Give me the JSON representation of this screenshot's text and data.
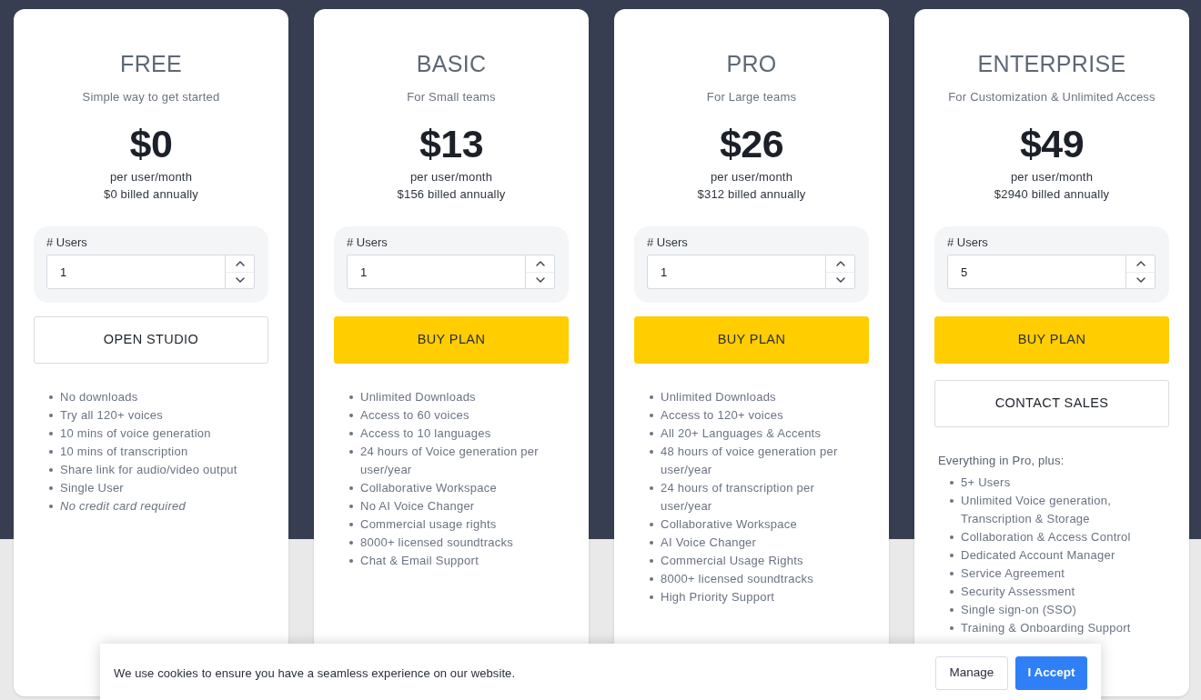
{
  "plans": [
    {
      "name": "FREE",
      "tagline": "Simple way to get started",
      "price": "$0",
      "period": "per user/month",
      "billed": "$0 billed annually",
      "users": {
        "label": "# Users",
        "value": "1"
      },
      "buttons": [
        {
          "label": "OPEN STUDIO",
          "kind": "outline"
        }
      ],
      "features": [
        "No downloads",
        "Try all 120+ voices",
        "10 mins of voice generation",
        "10 mins of transcription",
        "Share link for audio/video output",
        "Single User"
      ],
      "note": "No credit card required"
    },
    {
      "name": "BASIC",
      "tagline": "For Small teams",
      "price": "$13",
      "period": "per user/month",
      "billed": "$156 billed annually",
      "users": {
        "label": "# Users",
        "value": "1"
      },
      "buttons": [
        {
          "label": "BUY PLAN",
          "kind": "primary"
        }
      ],
      "features": [
        "Unlimited Downloads",
        "Access to 60 voices",
        "Access to 10 languages",
        "24 hours of Voice generation per user/year",
        "Collaborative Workspace",
        "No AI Voice Changer",
        "Commercial usage rights",
        "8000+ licensed soundtracks",
        "Chat & Email Support"
      ]
    },
    {
      "name": "PRO",
      "tagline": "For Large teams",
      "price": "$26",
      "period": "per user/month",
      "billed": "$312 billed annually",
      "users": {
        "label": "# Users",
        "value": "1"
      },
      "buttons": [
        {
          "label": "BUY PLAN",
          "kind": "primary"
        }
      ],
      "features": [
        "Unlimited Downloads",
        "Access to 120+ voices",
        "All 20+ Languages & Accents",
        "48 hours of voice generation per user/year",
        "24 hours of transcription per user/year",
        "Collaborative Workspace",
        "AI Voice Changer",
        "Commercial Usage Rights",
        "8000+ licensed soundtracks",
        "High Priority Support"
      ]
    },
    {
      "name": "ENTERPRISE",
      "tagline": "For Customization & Unlimited Access",
      "price": "$49",
      "period": "per user/month",
      "billed": "$2940 billed annually",
      "users": {
        "label": "# Users",
        "value": "5"
      },
      "buttons": [
        {
          "label": "BUY PLAN",
          "kind": "primary"
        },
        {
          "label": "CONTACT SALES",
          "kind": "outline"
        }
      ],
      "features_intro": "Everything in Pro, plus:",
      "features": [
        "5+ Users",
        "Unlimited Voice generation, Transcription & Storage",
        "Collaboration & Access Control",
        "Dedicated Account Manager",
        "Service Agreement",
        "Security Assessment",
        "Single sign-on (SSO)",
        "Training & Onboarding Support"
      ]
    }
  ],
  "cookie_banner": {
    "message": "We use cookies to ensure you have a seamless experience on our website.",
    "buttons": [
      {
        "label": "Manage",
        "kind": "secondary"
      },
      {
        "label": "I Accept",
        "kind": "primary"
      }
    ]
  }
}
